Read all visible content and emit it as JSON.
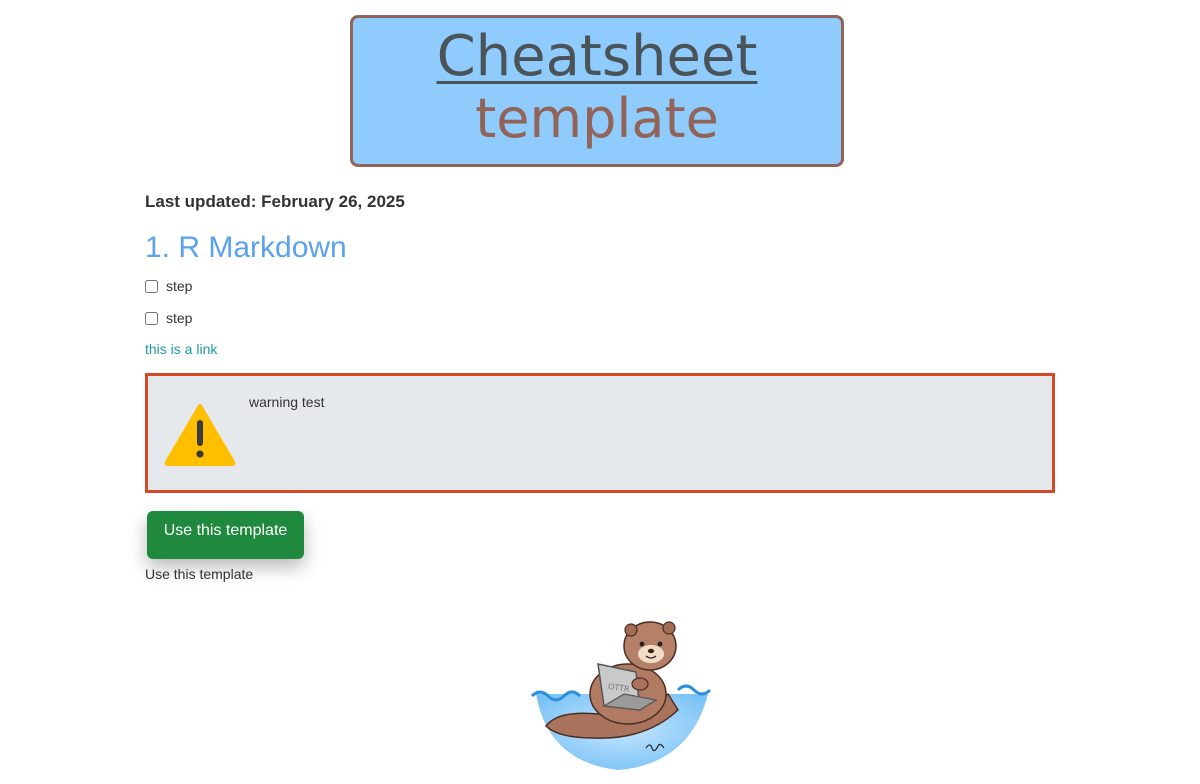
{
  "header": {
    "title_line1": "Cheatsheet",
    "title_line2": "template"
  },
  "last_updated": "Last updated: February 26, 2025",
  "section": {
    "heading": "1. R Markdown"
  },
  "checklist": [
    {
      "label": "step",
      "checked": false
    },
    {
      "label": "step",
      "checked": false
    }
  ],
  "link_text": "this is a link",
  "warning": {
    "icon": "warning-icon",
    "text": "warning test"
  },
  "template_button": {
    "label": "Use this template",
    "caption": "Use this template"
  },
  "colors": {
    "title_box_bg": "#8fcbfd",
    "title_box_border": "#926357",
    "heading_blue": "#5aa2ee",
    "link_teal": "#1f9aa2",
    "warning_border": "#d44a27",
    "button_green": "#1f8a3d",
    "warning_yellow": "#ffbe00"
  },
  "image": {
    "icon": "otter-with-laptop-illustration",
    "laptop_label": "OTTR"
  }
}
